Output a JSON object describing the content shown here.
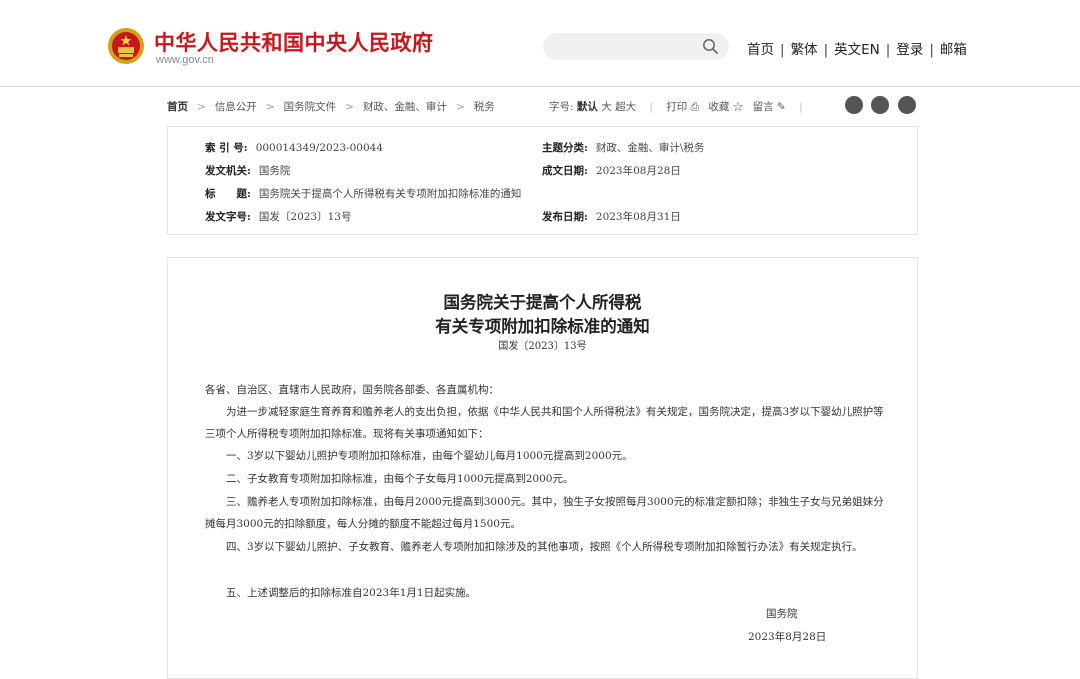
{
  "header": {
    "site_title": "中华人民共和国中央人民政府",
    "site_url": "www.gov.cn",
    "search_placeholder": "",
    "nav": [
      "首页",
      "繁体",
      "英文EN",
      "登录",
      "邮箱"
    ],
    "brand_color": "#c8161d"
  },
  "breadcrumb": {
    "items": [
      "首页",
      "信息公开",
      "国务院文件",
      "财政、金融、审计",
      "税务"
    ],
    "font_label": "字号:",
    "font_sizes": [
      "默认",
      "大",
      "超大"
    ],
    "print_label": "打印",
    "favorite_label": "收藏",
    "comment_label": "留言",
    "share_icons": [
      "weibo-icon",
      "wechat-icon",
      "favorite-share-icon"
    ]
  },
  "info": {
    "index_key": "索 引 号:",
    "index_val": "000014349/2023-00044",
    "topic_key": "主题分类:",
    "topic_val": "财政、金融、审计\\税务",
    "issuer_key": "发文机关:",
    "issuer_val": "国务院",
    "date_key": "成文日期:",
    "date_val": "2023年08月28日",
    "title_key": "标　　题:",
    "title_val": "国务院关于提高个人所得税有关专项附加扣除标准的通知",
    "docno_key": "发文字号:",
    "docno_val": "国发〔2023〕13号",
    "pub_key": "发布日期:",
    "pub_val": "2023年08月31日"
  },
  "article": {
    "title_line1": "国务院关于提高个人所得税",
    "title_line2": "有关专项附加扣除标准的通知",
    "docno": "国发〔2023〕13号",
    "salutation": "各省、自治区、直辖市人民政府，国务院各部委、各直属机构：",
    "p1": "　　为进一步减轻家庭生育养育和赡养老人的支出负担，依据《中华人民共和国个人所得税法》有关规定，国务院决定，提高3岁以下婴幼儿照护等三项个人所得税专项附加扣除标准。现将有关事项通知如下：",
    "p2": "　　一、3岁以下婴幼儿照护专项附加扣除标准，由每个婴幼儿每月1000元提高到2000元。",
    "p3": "　　二、子女教育专项附加扣除标准，由每个子女每月1000元提高到2000元。",
    "p4": "　　三、赡养老人专项附加扣除标准，由每月2000元提高到3000元。其中，独生子女按照每月3000元的标准定额扣除；非独生子女与兄弟姐妹分摊每月3000元的扣除额度，每人分摊的额度不能超过每月1500元。",
    "p5": "　　四、3岁以下婴幼儿照护、子女教育、赡养老人专项附加扣除涉及的其他事项，按照《个人所得税专项附加扣除暂行办法》有关规定执行。",
    "p6": "　　五、上述调整后的扣除标准自2023年1月1日起实施。",
    "sign_org": "国务院",
    "sign_date": "2023年8月28日"
  }
}
